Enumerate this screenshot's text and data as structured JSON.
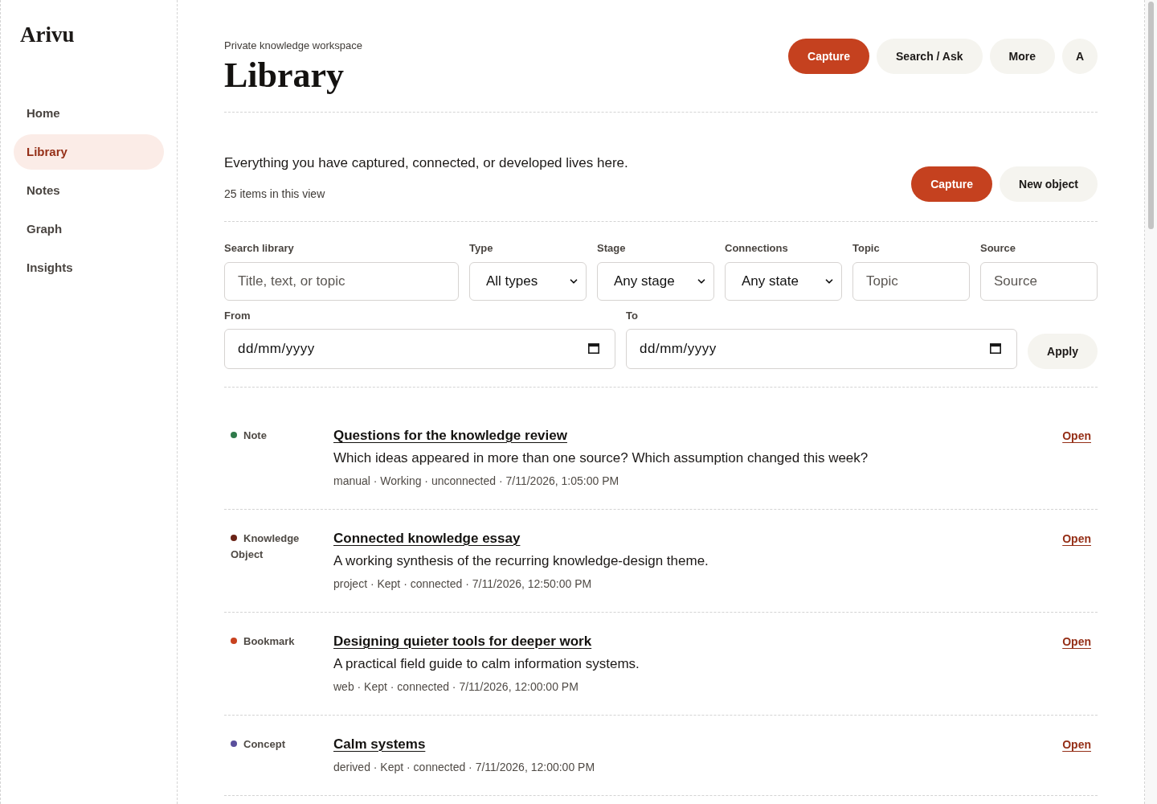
{
  "sidebar": {
    "logo": "Arivu",
    "items": [
      {
        "label": "Home",
        "selected": false
      },
      {
        "label": "Library",
        "selected": true
      },
      {
        "label": "Notes",
        "selected": false
      },
      {
        "label": "Graph",
        "selected": false
      },
      {
        "label": "Insights",
        "selected": false
      }
    ]
  },
  "header": {
    "eyebrow": "Private knowledge workspace",
    "title": "Library",
    "actions": [
      {
        "label": "Capture",
        "kind": "primary"
      },
      {
        "label": "Search / Ask",
        "kind": "secondary"
      },
      {
        "label": "More",
        "kind": "secondary"
      },
      {
        "label": "A",
        "kind": "avatar"
      }
    ]
  },
  "intro": {
    "text": "Everything you have captured, connected, or developed lives here.",
    "count": "25 items in this view",
    "actions": [
      {
        "label": "Capture",
        "kind": "primary"
      },
      {
        "label": "New object",
        "kind": "secondary"
      }
    ]
  },
  "filters": {
    "fields": [
      {
        "label": "Search library",
        "kind": "text",
        "placeholder": "Title, text, or topic"
      },
      {
        "label": "Type",
        "kind": "select",
        "value": "All types"
      },
      {
        "label": "Stage",
        "kind": "select",
        "value": "Any stage"
      },
      {
        "label": "Connections",
        "kind": "select",
        "value": "Any state"
      },
      {
        "label": "Topic",
        "kind": "text",
        "placeholder": "Topic"
      },
      {
        "label": "Source",
        "kind": "text",
        "placeholder": "Source"
      }
    ],
    "dates": [
      {
        "label": "From",
        "placeholder": "dd/mm/yyyy"
      },
      {
        "label": "To",
        "placeholder": "dd/mm/yyyy"
      }
    ],
    "apply": "Apply"
  },
  "items": [
    {
      "type": "Note",
      "color": "#2f7a4a",
      "title": "Questions for the knowledge review",
      "description": "Which ideas appeared in more than one source? Which assumption changed this week?",
      "meta": "manual · Working · unconnected · 7/11/2026, 1:05:00 PM",
      "action": "Open"
    },
    {
      "type": "Knowledge Object",
      "color": "#6a2317",
      "title": "Connected knowledge essay",
      "description": "A working synthesis of the recurring knowledge-design theme.",
      "meta": "project · Kept · connected · 7/11/2026, 12:50:00 PM",
      "action": "Open"
    },
    {
      "type": "Bookmark",
      "color": "#c8421f",
      "title": "Designing quieter tools for deeper work",
      "description": "A practical field guide to calm information systems.",
      "meta": "web · Kept · connected · 7/11/2026, 12:00:00 PM",
      "action": "Open"
    },
    {
      "type": "Concept",
      "color": "#5a4f9c",
      "title": "Calm systems",
      "meta": "derived · Kept · connected · 7/11/2026, 12:00:00 PM",
      "action": "Open"
    }
  ]
}
